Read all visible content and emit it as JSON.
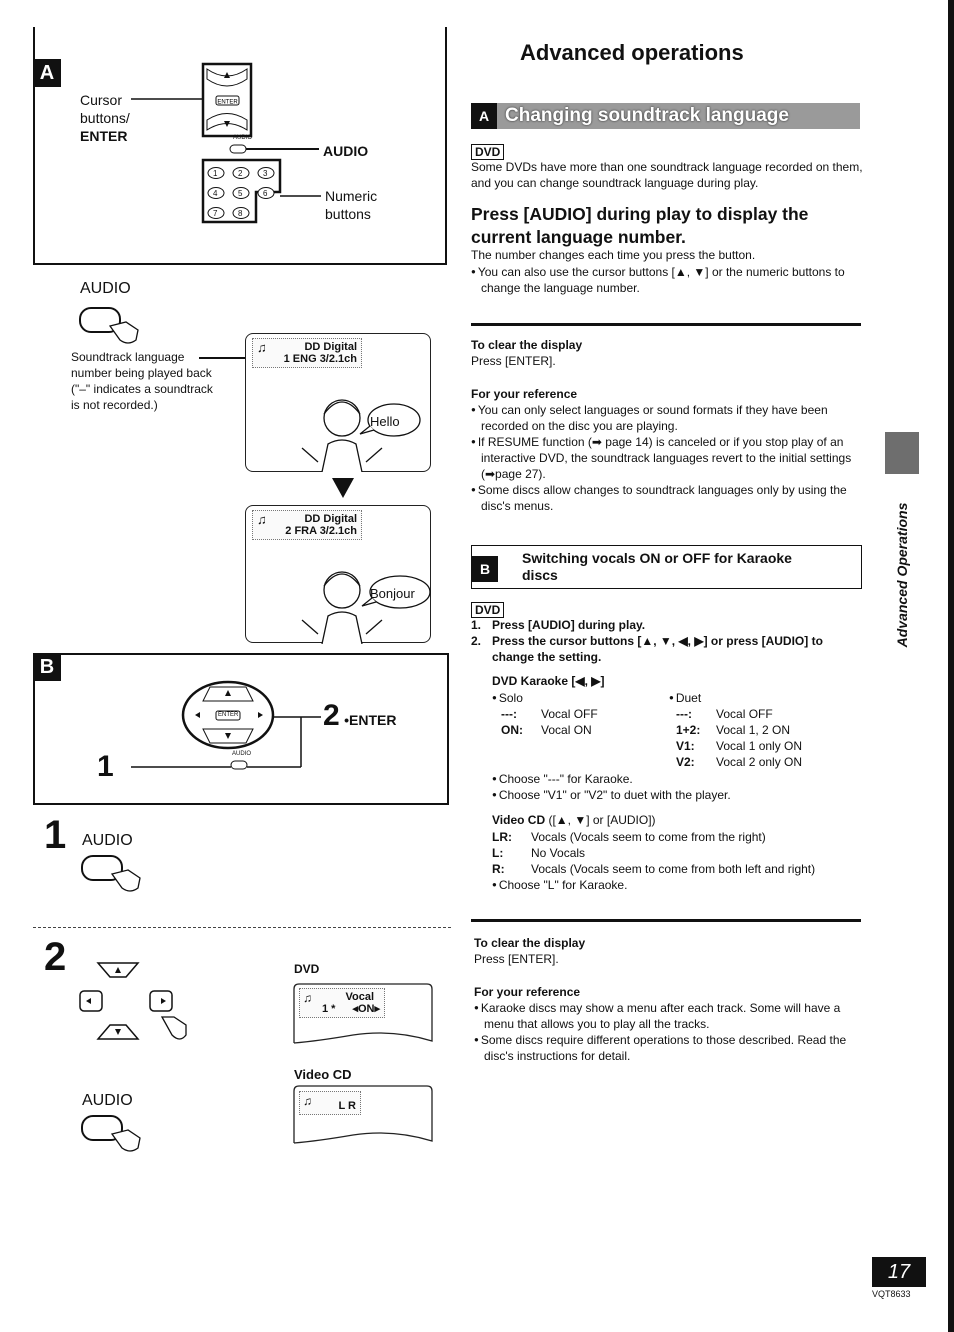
{
  "left": {
    "fig_a": {
      "label": "A",
      "cursor_label": [
        "Cursor",
        "buttons/"
      ],
      "enter_label": "ENTER",
      "audio_label": "AUDIO",
      "numeric_label": [
        "Numeric",
        "buttons"
      ],
      "remote_enter": "ENTER",
      "remote_audio_tiny": "AUDIO",
      "numeric_keys": [
        "1",
        "2",
        "3",
        "4",
        "5",
        "6",
        "7",
        "8"
      ]
    },
    "audio_demo": {
      "audio_label": "AUDIO",
      "caption": [
        "Soundtrack language",
        "number being played back",
        "(\"–\" indicates a soundtrack",
        "is not recorded.)"
      ],
      "screen1": {
        "line1": "DD Digital",
        "line2": "1 ENG  3/2.1ch",
        "speech": "Hello"
      },
      "screen2": {
        "line1": "DD Digital",
        "line2": "2 FRA  3/2.1ch",
        "speech": "Bonjour"
      }
    },
    "fig_b": {
      "label": "B",
      "step1": "1",
      "step2_num": "2",
      "step2_text": "•ENTER",
      "remote_enter": "ENTER",
      "remote_audio_tiny": "AUDIO"
    },
    "step1": {
      "num": "1",
      "audio_label": "AUDIO"
    },
    "step2": {
      "num": "2",
      "audio_label": "AUDIO",
      "dvd_label": "DVD",
      "dvd_screen": {
        "line1": "Vocal",
        "line2a": "1 *",
        "line2b": "◂ON▸"
      },
      "vcd_label": "Video CD",
      "vcd_screen": {
        "line1": "L R"
      }
    }
  },
  "right": {
    "page_title": "Advanced operations",
    "section_a": {
      "label": "A",
      "title": "Changing soundtrack language",
      "disc_tag": "DVD",
      "intro": "Some DVDs have more than one soundtrack language recorded on them, and you can change soundtrack language during play.",
      "heading": "Press [AUDIO] during play to display the current language number.",
      "body": "The number changes each time you press the button.",
      "bullet": "You can also use the cursor buttons [▲, ▼] or the numeric buttons to change the language number.",
      "clear_title": "To clear the display",
      "clear_body": "Press [ENTER].",
      "ref_title": "For your reference",
      "ref_bullets": [
        "You can only select languages or sound formats if they have been recorded on the disc you are playing.",
        "If RESUME function (➡ page 14) is canceled or if you stop play of an interactive DVD, the soundtrack languages revert to the initial settings (➡page 27).",
        "Some discs allow changes to soundtrack languages only by using the disc's menus."
      ]
    },
    "section_b": {
      "label": "B",
      "title": "Switching vocals ON or OFF for Karaoke discs",
      "disc_tag": "DVD",
      "steps": [
        {
          "num": "1.",
          "text": "Press [AUDIO] during play."
        },
        {
          "num": "2.",
          "text": "Press the cursor buttons [▲, ▼, ◀, ▶] or press [AUDIO] to change the setting."
        }
      ],
      "karaoke_title": "DVD Karaoke [◀, ▶]",
      "solo": {
        "label": "Solo",
        "rows": [
          {
            "k": "---:",
            "v": "Vocal OFF"
          },
          {
            "k": "ON:",
            "v": "Vocal ON"
          }
        ]
      },
      "duet": {
        "label": "Duet",
        "rows": [
          {
            "k": "---:",
            "v": "Vocal OFF"
          },
          {
            "k": "1+2:",
            "v": "Vocal 1, 2 ON"
          },
          {
            "k": "V1:",
            "v": "Vocal 1 only ON"
          },
          {
            "k": "V2:",
            "v": "Vocal 2 only ON"
          }
        ]
      },
      "karaoke_bullets": [
        "Choose \"---\" for Karaoke.",
        "Choose \"V1\" or \"V2\" to duet with the player."
      ],
      "vcd_title_bold": "Video CD",
      "vcd_title_rest": " ([▲, ▼] or [AUDIO])",
      "vcd_rows": [
        {
          "k": "LR:",
          "v": "Vocals (Vocals seem to come from the right)"
        },
        {
          "k": "L:",
          "v": "No Vocals"
        },
        {
          "k": "R:",
          "v": "Vocals (Vocals seem to come from both left and right)"
        }
      ],
      "vcd_bullet": "Choose \"L\" for Karaoke.",
      "clear_title": "To clear the display",
      "clear_body": "Press [ENTER].",
      "ref_title": "For your reference",
      "ref_bullets": [
        "Karaoke discs may show a menu after each track. Some will have a menu that allows you to play all the tracks.",
        "Some discs require different operations to those described. Read the disc's instructions for detail."
      ]
    }
  },
  "side_tab": {
    "text": "Advanced Operations"
  },
  "footer": {
    "page_number": "17",
    "code": "VQT8633"
  }
}
